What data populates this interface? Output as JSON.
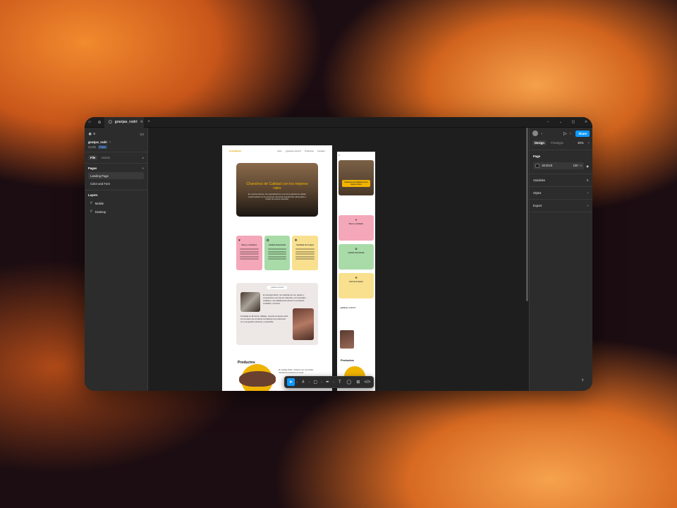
{
  "titlebar": {
    "tab_title": "granjas_rodri",
    "controls": [
      "–",
      "⌄",
      "◱",
      "✕"
    ]
  },
  "left_panel": {
    "file_name": "granjas_rodri",
    "drafts": "Drafts",
    "plan_badge": "Free",
    "tabs": [
      "File",
      "Assets"
    ],
    "pages_label": "Pages",
    "pages": [
      "Landing Page",
      "Color and Font"
    ],
    "layers_label": "Layers",
    "layers": [
      "Mobile",
      "Desktop"
    ]
  },
  "right_panel": {
    "share_label": "Share",
    "tabs": [
      "Design",
      "Prototype"
    ],
    "zoom": "30%",
    "page_label": "Page",
    "page_color": "1E1E1E",
    "page_opacity": "100",
    "percent": "%",
    "sections": [
      "Variables",
      "Styles",
      "Export"
    ]
  },
  "desktop_board": {
    "logo": "GranjaRodri",
    "nav": [
      "Inicio",
      "¿Quiénes somos?",
      "Productos",
      "Contacto"
    ],
    "hero_title": "Chanchos de Calidad con los mejores ratos",
    "hero_sub": "En nuestra empresa, nos especializamos en la cría de ganado de calidad, comprometidos con la excelencia, ofreciendo animales bien alimentados y criados de manera sostenible.",
    "cards": [
      {
        "title": "Sanos y Cuidados",
        "color": "#f4a7b9",
        "icon": "heart-icon"
      },
      {
        "title": "Calidad Garantizada",
        "color": "#a8dba8",
        "icon": "brain-icon"
      },
      {
        "title": "Facilidad de Compra",
        "color": "#f8e08e",
        "icon": "gift-icon"
      }
    ],
    "about_pill": "¿Quiénes somos?",
    "about_text1": "En Granjas Rodri, nos dedicamos con pasión y compromiso a la cría de chanchos, con animales cuidados y de calidad para ofrecer un producto confiable y cercano.",
    "about_text2": "Fundada en El Kemá, Hidalgo, nuestra empresa nació con la visión de combinar la tradición de producción con una gestión eficiente y sostenible.",
    "products_title": "Productos",
    "products_text": "En Granjas Rodri, contamos con una amplia variedad de productos de cerdo."
  },
  "mobile_board": {
    "hero_label": "Chanchos de Calidad con los mejores ratos",
    "cards": [
      {
        "title": "Sanos y Cuidados",
        "color": "#f4a7b9"
      },
      {
        "title": "Calidad Garantizada",
        "color": "#a8dba8"
      },
      {
        "title": "Facil de Comprar",
        "color": "#f8e08e"
      }
    ],
    "about_title": "¿Quiénes somos?",
    "products_title": "Productos"
  },
  "toolbar": {
    "tools": [
      "move-icon",
      "frame-icon",
      "shape-icon",
      "pen-icon",
      "text-icon",
      "comment-icon",
      "actions-icon",
      "dev-mode-icon"
    ]
  },
  "help_label": "?"
}
